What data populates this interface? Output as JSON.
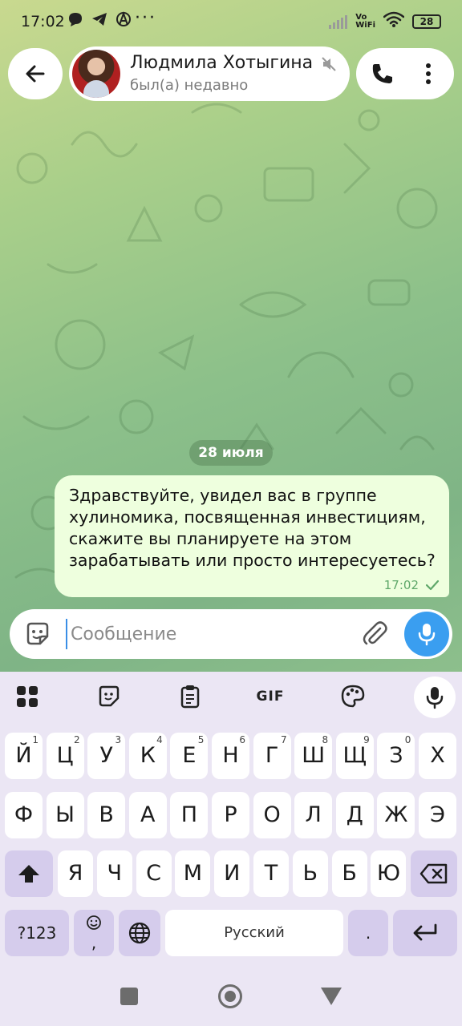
{
  "status_bar": {
    "time": "17:02",
    "more": "···",
    "vowifi_top": "Vo",
    "vowifi_bottom": "WiFi",
    "battery": "28"
  },
  "header": {
    "name": "Людмила Хотыгина",
    "status": "был(а) недавно"
  },
  "chat": {
    "date_chip": "28 июля",
    "messages": [
      {
        "text": "Здравствуйте, увидел вас в группе хулиномика, посвященная инвестициям, скажите вы планируете на этом зарабатывать или просто интересуетесь?",
        "time": "17:02",
        "status_icon": "single-check-icon"
      }
    ]
  },
  "composer": {
    "placeholder": "Сообщение"
  },
  "keyboard": {
    "toolbar": {
      "gif_label": "GIF"
    },
    "row1": [
      {
        "k": "Й",
        "h": "1"
      },
      {
        "k": "Ц",
        "h": "2"
      },
      {
        "k": "У",
        "h": "3"
      },
      {
        "k": "К",
        "h": "4"
      },
      {
        "k": "Е",
        "h": "5"
      },
      {
        "k": "Н",
        "h": "6"
      },
      {
        "k": "Г",
        "h": "7"
      },
      {
        "k": "Ш",
        "h": "8"
      },
      {
        "k": "Щ",
        "h": "9"
      },
      {
        "k": "З",
        "h": "0"
      },
      {
        "k": "Х",
        "h": ""
      }
    ],
    "row2": [
      "Ф",
      "Ы",
      "В",
      "А",
      "П",
      "Р",
      "О",
      "Л",
      "Д",
      "Ж",
      "Э"
    ],
    "row3": [
      "Я",
      "Ч",
      "С",
      "М",
      "И",
      "Т",
      "Ь",
      "Б",
      "Ю"
    ],
    "symbols_label": "?123",
    "comma_label": ",",
    "space_label": "Русский",
    "period_label": "."
  },
  "colors": {
    "accent": "#3a9ef0",
    "bubble_out": "#eeffde",
    "keyboard_bg": "#ebe6f4"
  }
}
